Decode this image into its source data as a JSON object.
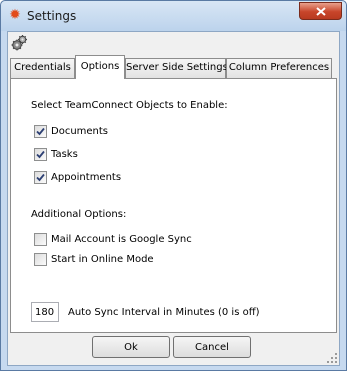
{
  "window": {
    "title": "Settings"
  },
  "tabs": [
    {
      "label": "Credentials",
      "active": false
    },
    {
      "label": "Options",
      "active": true
    },
    {
      "label": "Server Side Settings",
      "active": false
    },
    {
      "label": "Column Preferences",
      "active": false
    }
  ],
  "options": {
    "objects_heading": "Select TeamConnect Objects to Enable:",
    "objects": [
      {
        "label": "Documents",
        "checked": true
      },
      {
        "label": "Tasks",
        "checked": true
      },
      {
        "label": "Appointments",
        "checked": true
      }
    ],
    "additional_heading": "Additional Options:",
    "additional": [
      {
        "label": "Mail Account is Google Sync",
        "checked": false
      },
      {
        "label": "Start in Online Mode",
        "checked": false
      }
    ],
    "interval_value": "180",
    "interval_label": "Auto Sync Interval in Minutes (0 is off)"
  },
  "buttons": {
    "ok": "Ok",
    "cancel": "Cancel"
  },
  "icons": {
    "title": "settings-burst-icon",
    "toolbar": "gears-icon",
    "close": "close-icon"
  }
}
